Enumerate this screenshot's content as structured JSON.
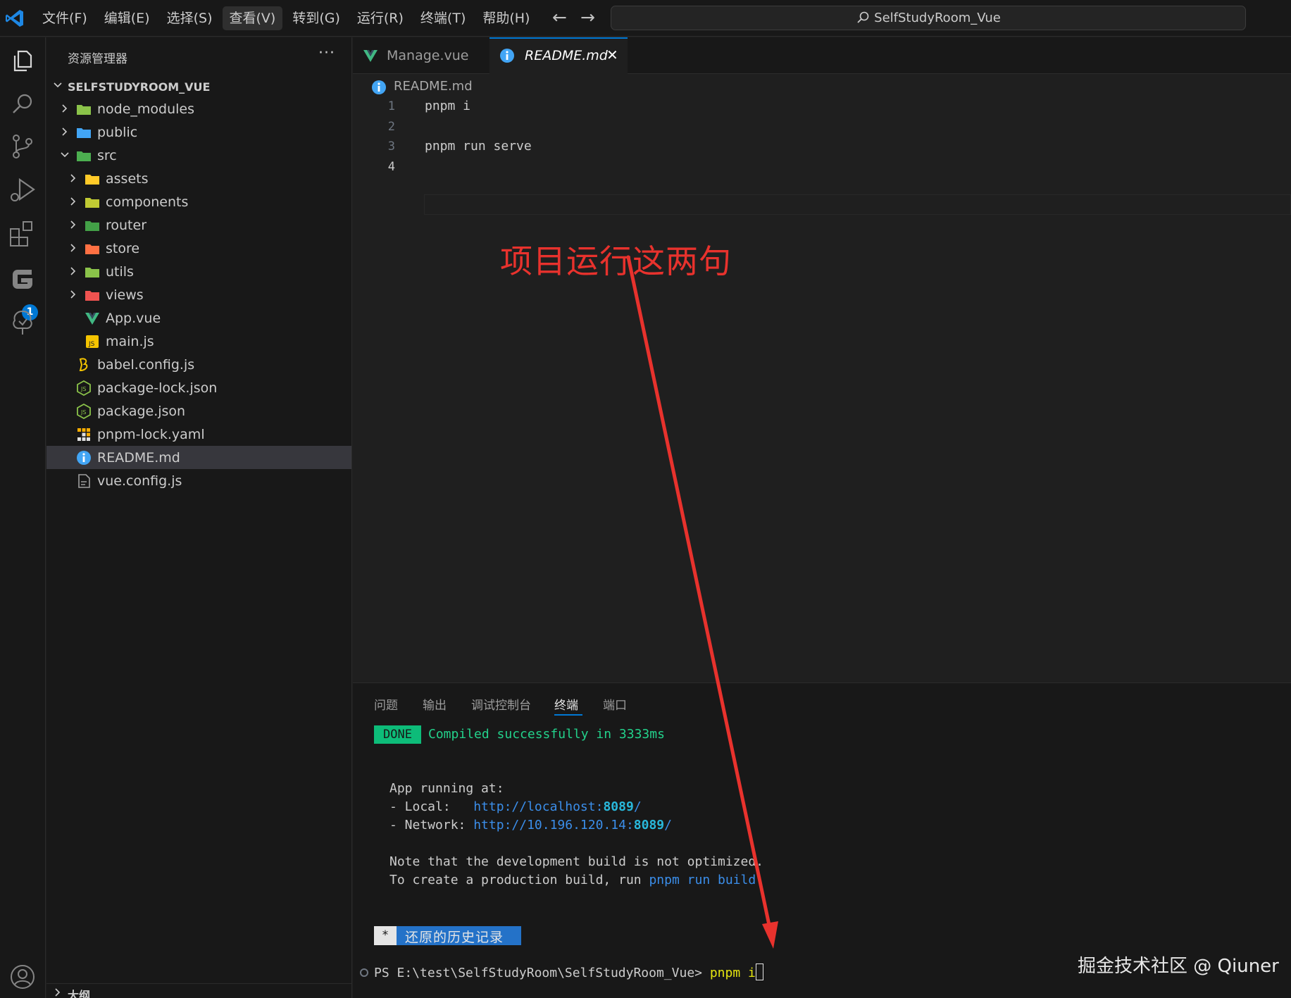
{
  "titlebar": {
    "menu": [
      "文件(F)",
      "编辑(E)",
      "选择(S)",
      "查看(V)",
      "转到(G)",
      "运行(R)",
      "终端(T)",
      "帮助(H)"
    ],
    "active_menu": "查看(V)",
    "back": "←",
    "forward": "→",
    "search_text": "SelfStudyRoom_Vue"
  },
  "activitybar": {
    "icons": [
      "explorer-icon",
      "search-icon",
      "source-control-icon",
      "run-debug-icon",
      "extensions-icon",
      "gitee-icon",
      "tree-icon",
      "account-icon"
    ],
    "extensions_badge": "1"
  },
  "sidebar": {
    "title": "资源管理器",
    "more": "···",
    "root": "SELFSTUDYROOM_VUE",
    "items": [
      {
        "label": "node_modules",
        "kind": "folder",
        "icon": "node-folder-icon",
        "color": "#8bc34a"
      },
      {
        "label": "public",
        "kind": "folder",
        "icon": "public-folder-icon",
        "color": "#42a5f5"
      },
      {
        "label": "src",
        "kind": "folder-open",
        "icon": "src-folder-icon",
        "color": "#4caf50"
      },
      {
        "label": "assets",
        "kind": "folder",
        "icon": "assets-folder-icon",
        "color": "#ffca28"
      },
      {
        "label": "components",
        "kind": "folder",
        "icon": "components-folder-icon",
        "color": "#c0ca33"
      },
      {
        "label": "router",
        "kind": "folder",
        "icon": "router-folder-icon",
        "color": "#43a047"
      },
      {
        "label": "store",
        "kind": "folder",
        "icon": "store-folder-icon",
        "color": "#ff7043"
      },
      {
        "label": "utils",
        "kind": "folder",
        "icon": "utils-folder-icon",
        "color": "#8bc34a"
      },
      {
        "label": "views",
        "kind": "folder",
        "icon": "views-folder-icon",
        "color": "#ef5350"
      },
      {
        "label": "App.vue",
        "kind": "file",
        "icon": "vue-file-icon",
        "color": "#41b883"
      },
      {
        "label": "main.js",
        "kind": "file",
        "icon": "js-file-icon",
        "color": "#f5c400"
      },
      {
        "label": "babel.config.js",
        "kind": "file",
        "icon": "babel-file-icon",
        "color": "#f5c400"
      },
      {
        "label": "package-lock.json",
        "kind": "file",
        "icon": "nodejs-file-icon",
        "color": "#8bc34a"
      },
      {
        "label": "package.json",
        "kind": "file",
        "icon": "nodejs-file-icon",
        "color": "#8bc34a"
      },
      {
        "label": "pnpm-lock.yaml",
        "kind": "file",
        "icon": "pnpm-file-icon",
        "color": "#f9ad00"
      },
      {
        "label": "README.md",
        "kind": "file",
        "icon": "info-file-icon",
        "color": "#42a5f5"
      },
      {
        "label": "vue.config.js",
        "kind": "file",
        "icon": "config-file-icon",
        "color": "#9e9e9e"
      }
    ],
    "selected": "README.md",
    "outline": "大纲"
  },
  "editor": {
    "tabs": [
      {
        "label": "Manage.vue",
        "icon": "vue-file-icon",
        "active": false
      },
      {
        "label": "README.md",
        "icon": "info-file-icon",
        "active": true
      }
    ],
    "close": "✕",
    "breadcrumb": "README.md",
    "line_numbers": [
      "1",
      "2",
      "3",
      "4"
    ],
    "lines": [
      "pnpm i",
      "",
      "pnpm run serve",
      ""
    ]
  },
  "annotation": {
    "text": "项目运行这两句",
    "color": "#e8322d"
  },
  "panel": {
    "tabs": [
      "问题",
      "输出",
      "调试控制台",
      "终端",
      "端口"
    ],
    "active_tab": "终端",
    "done": "DONE",
    "compiled": "Compiled successfully in 3333ms",
    "app_running": "App running at:",
    "local_label": "- Local:   ",
    "local_url_prefix": "http://localhost:",
    "local_port": "8089",
    "local_url_suffix": "/",
    "network_label": "- Network: ",
    "network_url_prefix": "http://10.196.120.14:",
    "network_port": "8089",
    "network_url_suffix": "/",
    "note": "Note that the development build is not optimized.",
    "create_prefix": "To create a production build, run ",
    "create_cmd": "pnpm run build",
    "create_suffix": ".",
    "restore_star": "*",
    "restore_text": "还原的历史记录",
    "prompt": "PS E:\\test\\SelfStudyRoom\\SelfStudyRoom_Vue> ",
    "command": "pnpm i"
  },
  "watermark": "掘金技术社区 @ Qiuner"
}
